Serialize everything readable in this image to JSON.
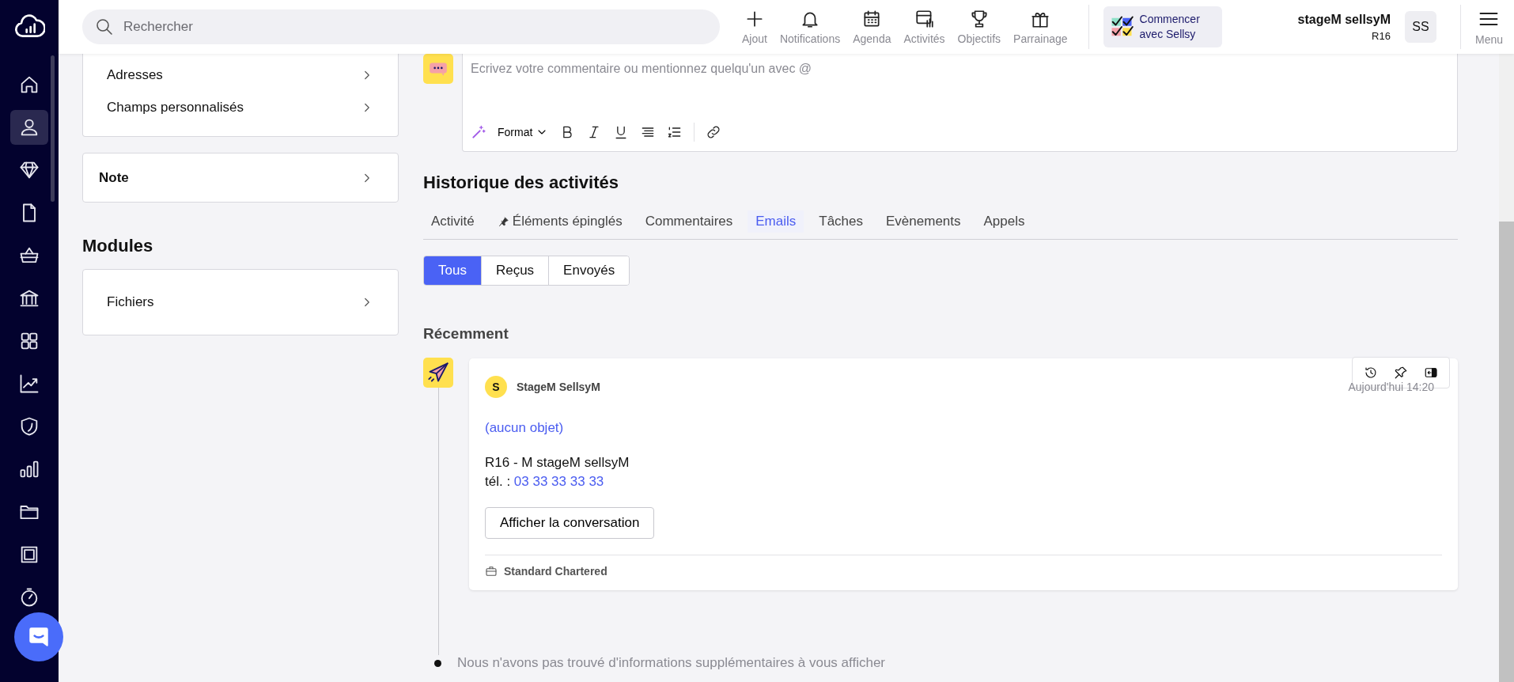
{
  "nav": {
    "items": [
      {
        "selected": false
      },
      {
        "selected": true
      },
      {
        "selected": false
      },
      {
        "selected": false
      },
      {
        "selected": false
      },
      {
        "selected": false
      },
      {
        "selected": false
      },
      {
        "selected": false
      },
      {
        "selected": false
      },
      {
        "selected": false
      },
      {
        "selected": false
      },
      {
        "selected": false
      },
      {
        "selected": false
      }
    ]
  },
  "search": {
    "placeholder": "Rechercher"
  },
  "top_actions": [
    {
      "label": "Ajout"
    },
    {
      "label": "Notifications"
    },
    {
      "label": "Agenda"
    },
    {
      "label": "Activités"
    },
    {
      "label": "Objectifs"
    },
    {
      "label": "Parrainage"
    }
  ],
  "onboarding": {
    "label": "Commencer avec Sellsy"
  },
  "user": {
    "name": "stageM sellsyM",
    "code": "R16",
    "initials": "SS"
  },
  "menu": {
    "label": "Menu"
  },
  "left_panel": {
    "contact_links": [
      "Adresses",
      "Champs personnalisés"
    ],
    "note": "Note",
    "modules_title": "Modules",
    "modules": [
      "Fichiers"
    ]
  },
  "comment": {
    "placeholder": "Ecrivez votre commentaire ou mentionnez quelqu'un avec @",
    "format_label": "Format"
  },
  "history": {
    "title": "Historique des activités",
    "tabs": [
      {
        "label": "Activité",
        "kind": "plain",
        "selected": false
      },
      {
        "label": "Éléments épinglés",
        "kind": "pinned",
        "selected": false
      },
      {
        "label": "Commentaires",
        "kind": "plain",
        "selected": false
      },
      {
        "label": "Emails",
        "kind": "plain",
        "selected": true
      },
      {
        "label": "Tâches",
        "kind": "plain",
        "selected": false
      },
      {
        "label": "Evènements",
        "kind": "plain",
        "selected": false
      },
      {
        "label": "Appels",
        "kind": "plain",
        "selected": false
      }
    ],
    "filters": [
      {
        "label": "Tous",
        "selected": true
      },
      {
        "label": "Reçus",
        "selected": false
      },
      {
        "label": "Envoyés",
        "selected": false
      }
    ],
    "recent_title": "Récemment",
    "activity": {
      "author_initial": "S",
      "author": "StageM SellsyM",
      "time": "Aujourd'hui 14:20",
      "subject": "(aucun objet)",
      "body": "R16 - M stageM sellsyM",
      "phone_label": "tél. :",
      "phone": "03 33 33 33 33",
      "button": "Afficher la conversation",
      "company": "Standard Chartered"
    },
    "end_note": "Nous n'avons pas trouvé d'informations supplémentaires à vous afficher"
  }
}
